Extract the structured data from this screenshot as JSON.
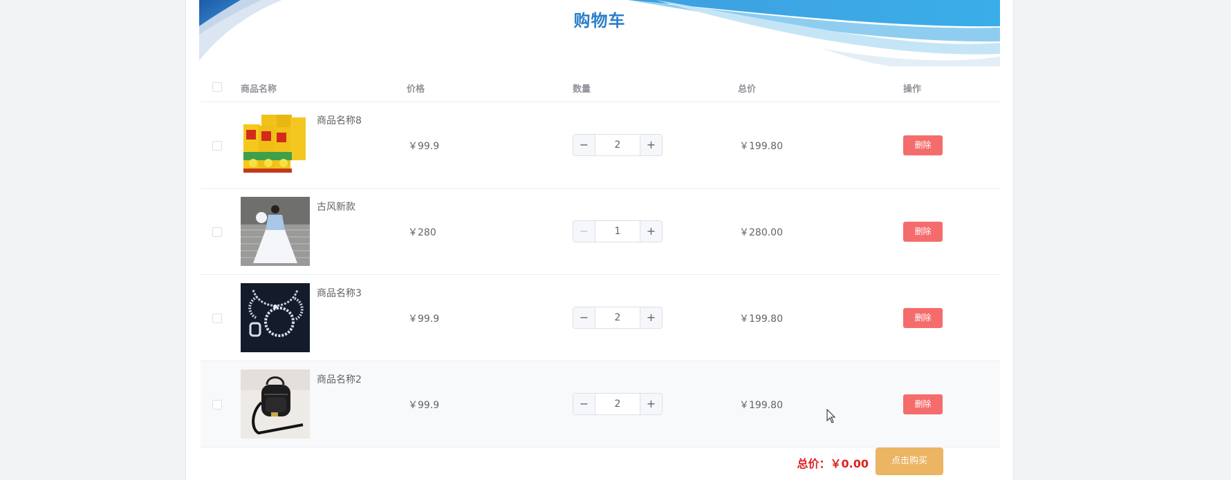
{
  "page": {
    "title": "购物车",
    "accent": "#2a7fc9"
  },
  "table": {
    "headers": {
      "name": "商品名称",
      "price": "价格",
      "quantity": "数量",
      "total": "总价",
      "action": "操作"
    },
    "rows": [
      {
        "name": "商品名称8",
        "price": "￥99.9",
        "quantity": "2",
        "total": "￥199.80",
        "delete": "删除",
        "image": "juice-boxes-image",
        "minus_disabled": false
      },
      {
        "name": "古风新款",
        "price": "￥280",
        "quantity": "1",
        "total": "￥280.00",
        "delete": "删除",
        "image": "hanfu-dress-image",
        "minus_disabled": true
      },
      {
        "name": "商品名称3",
        "price": "￥99.9",
        "quantity": "2",
        "total": "￥199.80",
        "delete": "删除",
        "image": "jewelry-set-image",
        "minus_disabled": false
      },
      {
        "name": "商品名称2",
        "price": "￥99.9",
        "quantity": "2",
        "total": "￥199.80",
        "delete": "删除",
        "image": "black-backpack-image",
        "minus_disabled": false
      }
    ]
  },
  "footer": {
    "total_label": "总价：￥0.00",
    "buy_label": "点击购买"
  },
  "colors": {
    "delete": "#f56c6c",
    "buy": "#ebb563",
    "total_text": "#e02020"
  }
}
